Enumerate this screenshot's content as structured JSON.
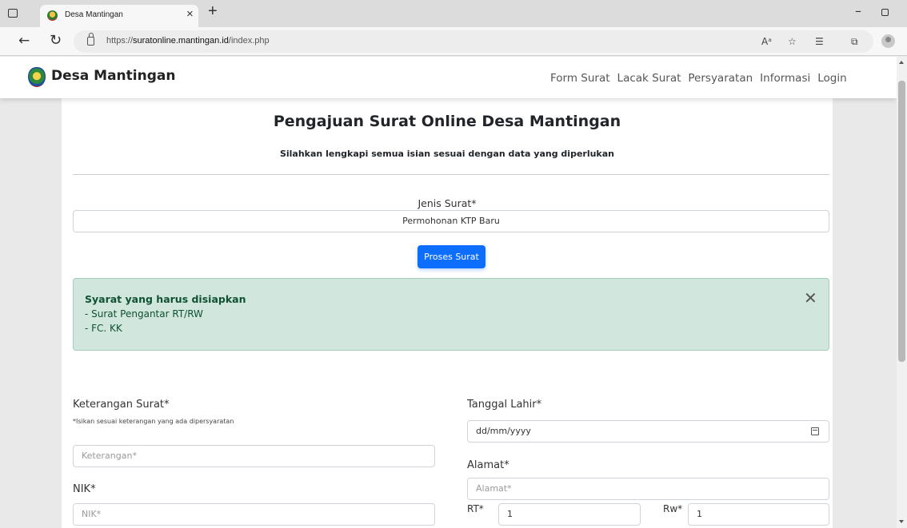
{
  "browser": {
    "tab_title": "Desa Mantingan",
    "tab_close": "×",
    "new_tab": "+",
    "url_scheme_host_prefix": "https://",
    "url_host": "suratonline.mantingan.id",
    "url_path": "/index.php"
  },
  "navbar": {
    "brand": "Desa Mantingan",
    "links": [
      "Form Surat",
      "Lacak Surat",
      "Persyaratan",
      "Informasi",
      "Login"
    ]
  },
  "form": {
    "title": "Pengajuan Surat Online Desa Mantingan",
    "subtitle": "Silahkan lengkapi semua isian sesuai dengan data yang diperlukan",
    "jenis_label": "Jenis Surat*",
    "jenis_value": "Permohonan KTP Baru",
    "proses_button": "Proses Surat",
    "alert": {
      "title": "Syarat yang harus disiapkan",
      "items": [
        "- Surat Pengantar RT/RW",
        "- FC. KK"
      ],
      "close": "✕"
    },
    "keterangan_label": "Keterangan Surat*",
    "keterangan_hint": "*Isikan sesuai keterangan yang ada dipersyaratan",
    "keterangan_placeholder": "Keterangan*",
    "nik_label": "NIK*",
    "nik_placeholder": "NIK*",
    "tanggal_label": "Tanggal Lahir*",
    "tanggal_placeholder": "dd/mm/yyyy",
    "alamat_label": "Alamat*",
    "alamat_placeholder": "Alamat*",
    "rt_label": "RT*",
    "rt_value": "1",
    "rw_label": "Rw*",
    "rw_value": "1"
  }
}
